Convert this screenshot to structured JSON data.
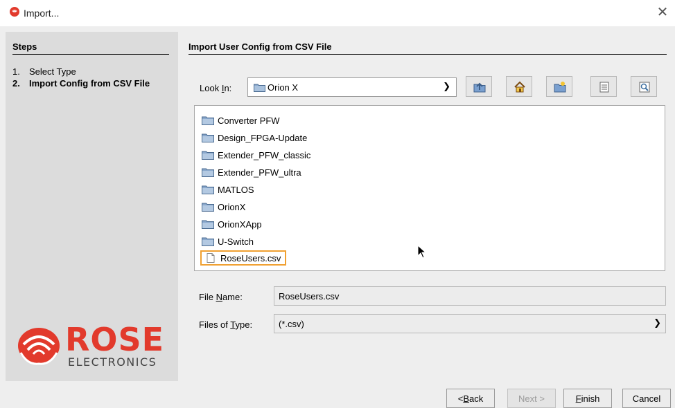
{
  "window": {
    "title": "Import...",
    "close_glyph": "✕",
    "icon": "rose-icon"
  },
  "steps": {
    "header": "Steps",
    "items": [
      {
        "num": "1.",
        "label": "Select Type"
      },
      {
        "num": "2.",
        "label": "Import  Config from CSV File"
      }
    ]
  },
  "logo": {
    "word": "ROSE",
    "sub": "ELECTRONICS"
  },
  "content": {
    "header": "Import User Config from CSV File",
    "look_in": {
      "label_pre": "Look ",
      "label_mnemonic": "I",
      "label_post": "n:",
      "value": "Orion X"
    },
    "toolbar": {
      "up": "up-folder-icon",
      "home": "home-icon",
      "new_folder": "new-folder-icon",
      "list": "list-view-icon",
      "details": "details-view-icon"
    },
    "files": [
      {
        "name": "Converter PFW",
        "type": "folder"
      },
      {
        "name": "Design_FPGA-Update",
        "type": "folder"
      },
      {
        "name": "Extender_PFW_classic",
        "type": "folder"
      },
      {
        "name": "Extender_PFW_ultra",
        "type": "folder"
      },
      {
        "name": "MATLOS",
        "type": "folder"
      },
      {
        "name": "OrionX",
        "type": "folder"
      },
      {
        "name": "OrionXApp",
        "type": "folder"
      },
      {
        "name": "U-Switch",
        "type": "folder"
      },
      {
        "name": "RoseUsers.csv",
        "type": "file",
        "selected": true
      }
    ],
    "file_name": {
      "label_pre": "File ",
      "label_mnemonic": "N",
      "label_post": "ame:",
      "value": "RoseUsers.csv"
    },
    "file_type": {
      "label_pre": "Files of ",
      "label_mnemonic": "T",
      "label_post": "ype:",
      "value": "(*.csv)"
    }
  },
  "buttons": {
    "back_pre": "< ",
    "back_mnemonic": "B",
    "back_post": "ack",
    "next": "Next >",
    "finish_mnemonic": "F",
    "finish_post": "inish",
    "cancel": "Cancel"
  },
  "colors": {
    "accent_selection": "#f0a030",
    "brand_red": "#e23a2c",
    "folder": "#6a8fb8"
  }
}
